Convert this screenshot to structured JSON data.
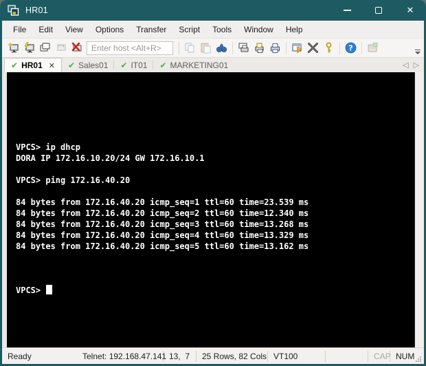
{
  "window": {
    "title": "HR01"
  },
  "menu": {
    "items": [
      "File",
      "Edit",
      "View",
      "Options",
      "Transfer",
      "Script",
      "Tools",
      "Window",
      "Help"
    ]
  },
  "toolbar": {
    "host_placeholder": "Enter host <Alt+R>",
    "icons": [
      "connect",
      "quick-connect",
      "connect-in-tab",
      "reconnect",
      "disconnect",
      "copy",
      "paste",
      "find",
      "print-screen",
      "print-selection",
      "print",
      "session-options",
      "global-options",
      "key-agent",
      "help",
      "securefx"
    ]
  },
  "tabs": [
    {
      "label": "HR01",
      "active": true,
      "status": "connected"
    },
    {
      "label": "Sales01",
      "active": false,
      "status": "connected"
    },
    {
      "label": "IT01",
      "active": false,
      "status": "connected"
    },
    {
      "label": "MARKETING01",
      "active": false,
      "status": "connected"
    }
  ],
  "terminal": {
    "lines": [
      "",
      "VPCS> ip dhcp",
      "DORA IP 172.16.10.20/24 GW 172.16.10.1",
      "",
      "VPCS> ping 172.16.40.20",
      "",
      "84 bytes from 172.16.40.20 icmp_seq=1 ttl=60 time=23.539 ms",
      "84 bytes from 172.16.40.20 icmp_seq=2 ttl=60 time=12.340 ms",
      "84 bytes from 172.16.40.20 icmp_seq=3 ttl=60 time=13.268 ms",
      "84 bytes from 172.16.40.20 icmp_seq=4 ttl=60 time=13.329 ms",
      "84 bytes from 172.16.40.20 icmp_seq=5 ttl=60 time=13.162 ms",
      ""
    ],
    "prompt": "VPCS> "
  },
  "status_bar": {
    "ready": "Ready",
    "connection": "Telnet: 192.168.47.141",
    "cursor_position": "13,  7",
    "screen_size": "25 Rows, 82 Cols",
    "emulation": "VT100",
    "cap": "CAP",
    "num": "NUM"
  }
}
